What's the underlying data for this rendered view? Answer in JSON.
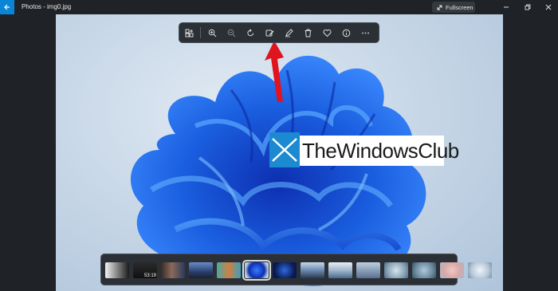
{
  "window": {
    "title": "Photos - img0.jpg",
    "fullscreen_label": "Fullscreen"
  },
  "toolbar": {
    "buttons": [
      "view-photos-icon",
      "zoom-in-icon",
      "zoom-out-icon",
      "rotate-icon",
      "edit-image-icon",
      "draw-icon",
      "delete-icon",
      "favorite-icon",
      "info-icon",
      "more-icon"
    ]
  },
  "watermark": {
    "text": "TheWindowsClub"
  },
  "filmstrip": {
    "thumbnails": [
      {
        "name": "thumb-1",
        "duration": ""
      },
      {
        "name": "thumb-2",
        "duration": "53:19"
      },
      {
        "name": "thumb-3",
        "duration": ""
      },
      {
        "name": "thumb-4",
        "duration": ""
      },
      {
        "name": "thumb-5",
        "duration": ""
      },
      {
        "name": "thumb-6",
        "duration": "",
        "selected": true
      },
      {
        "name": "thumb-7",
        "duration": ""
      },
      {
        "name": "thumb-8",
        "duration": ""
      },
      {
        "name": "thumb-9",
        "duration": ""
      },
      {
        "name": "thumb-10",
        "duration": ""
      },
      {
        "name": "thumb-11",
        "duration": ""
      },
      {
        "name": "thumb-12",
        "duration": ""
      },
      {
        "name": "thumb-13",
        "duration": ""
      },
      {
        "name": "thumb-14",
        "duration": ""
      }
    ]
  },
  "colors": {
    "accent": "#0a84d6",
    "annotation_arrow": "#e0141e",
    "bloom": "#1a5fe0"
  }
}
